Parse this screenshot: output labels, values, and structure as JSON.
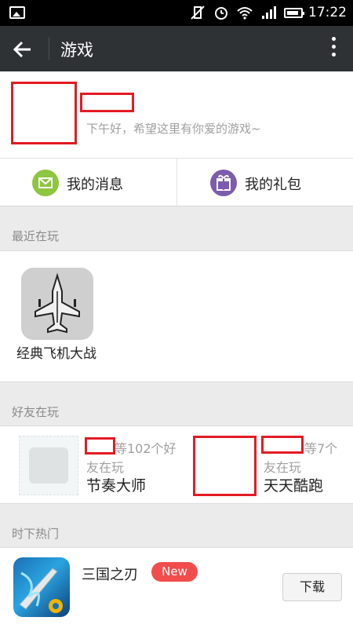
{
  "statusbar": {
    "time": "17:22"
  },
  "titlebar": {
    "title": "游戏"
  },
  "profile": {
    "greeting": "下午好，希望这里有你爱的游戏~"
  },
  "actions": {
    "messages_label": "我的消息",
    "gifts_label": "我的礼包"
  },
  "recent": {
    "header": "最近在玩",
    "games": [
      {
        "name": "经典飞机大战"
      }
    ]
  },
  "friends": {
    "header": "好友在玩",
    "items": [
      {
        "count_line": "等102个好",
        "line2": "友在玩",
        "game": "节奏大师"
      },
      {
        "count_line": "等7个",
        "line2": "友在玩",
        "game": "天天酷跑"
      }
    ]
  },
  "hot": {
    "header": "时下热门",
    "items": [
      {
        "name": "三国之刃",
        "badge": "New",
        "button": "下载"
      }
    ]
  },
  "colors": {
    "redact": "#e31b23",
    "titlebar": "#2f3235",
    "badge": "#f24d4d",
    "msg_icon": "#8dc63f",
    "gift_icon": "#7c5cac"
  }
}
